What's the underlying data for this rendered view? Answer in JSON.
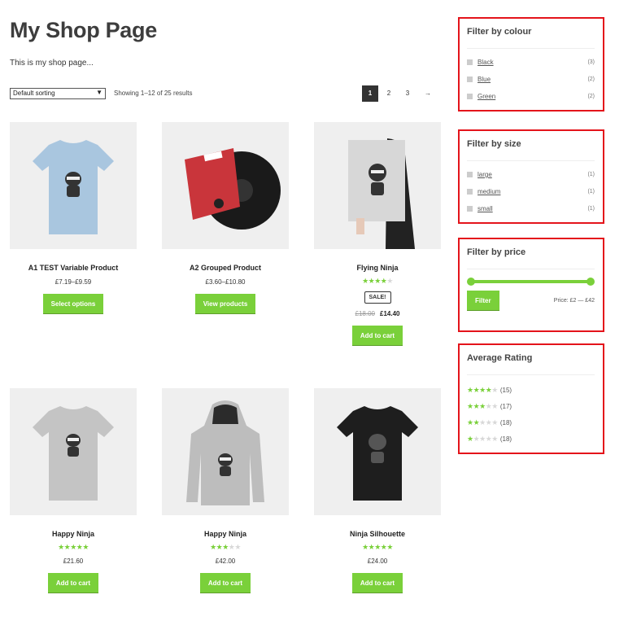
{
  "page": {
    "title": "My Shop Page",
    "description": "This is my shop page..."
  },
  "toolbar": {
    "sort_value": "Default sorting",
    "result_count": "Showing 1–12 of 25 results"
  },
  "pagination": {
    "pages": [
      "1",
      "2",
      "3"
    ],
    "current": "1",
    "next": "→"
  },
  "products": [
    {
      "name": "A1 TEST Variable Product",
      "price": "£7.19–£9.59",
      "button": "Select options",
      "image": "blue-tshirt-ninja"
    },
    {
      "name": "A2 Grouped Product",
      "price": "£3.60–£10.80",
      "button": "View products",
      "image": "vinyl-record-woo"
    },
    {
      "name": "Flying Ninja",
      "rating": 4,
      "sale": "SALE!",
      "old_price": "£18.00",
      "price": "£14.40",
      "button": "Add to cart",
      "image": "ninja-poster"
    },
    {
      "name": "Happy Ninja",
      "rating": 5,
      "price": "£21.60",
      "button": "Add to cart",
      "image": "grey-tshirt-ninja"
    },
    {
      "name": "Happy Ninja",
      "rating": 3,
      "price": "£42.00",
      "button": "Add to cart",
      "image": "grey-hoodie-ninja"
    },
    {
      "name": "Ninja Silhouette",
      "rating": 5,
      "price": "£24.00",
      "button": "Add to cart",
      "image": "black-tshirt-ninja"
    }
  ],
  "sidebar": {
    "colour": {
      "title": "Filter by colour",
      "items": [
        {
          "label": "Black",
          "count": "(3)"
        },
        {
          "label": "Blue",
          "count": "(2)"
        },
        {
          "label": "Green",
          "count": "(2)"
        }
      ]
    },
    "size": {
      "title": "Filter by size",
      "items": [
        {
          "label": "large",
          "count": "(1)"
        },
        {
          "label": "medium",
          "count": "(1)"
        },
        {
          "label": "small",
          "count": "(1)"
        }
      ]
    },
    "price": {
      "title": "Filter by price",
      "button": "Filter",
      "label": "Price: £2 — £42",
      "range_min": 2,
      "range_max": 42
    },
    "rating": {
      "title": "Average Rating",
      "items": [
        {
          "stars": 4,
          "count": "(15)"
        },
        {
          "stars": 3,
          "count": "(17)"
        },
        {
          "stars": 2,
          "count": "(18)"
        },
        {
          "stars": 1,
          "count": "(18)"
        }
      ]
    }
  },
  "colors": {
    "accent": "#7ad03a",
    "widget_border": "#e4141b",
    "current_page": "#333333"
  }
}
